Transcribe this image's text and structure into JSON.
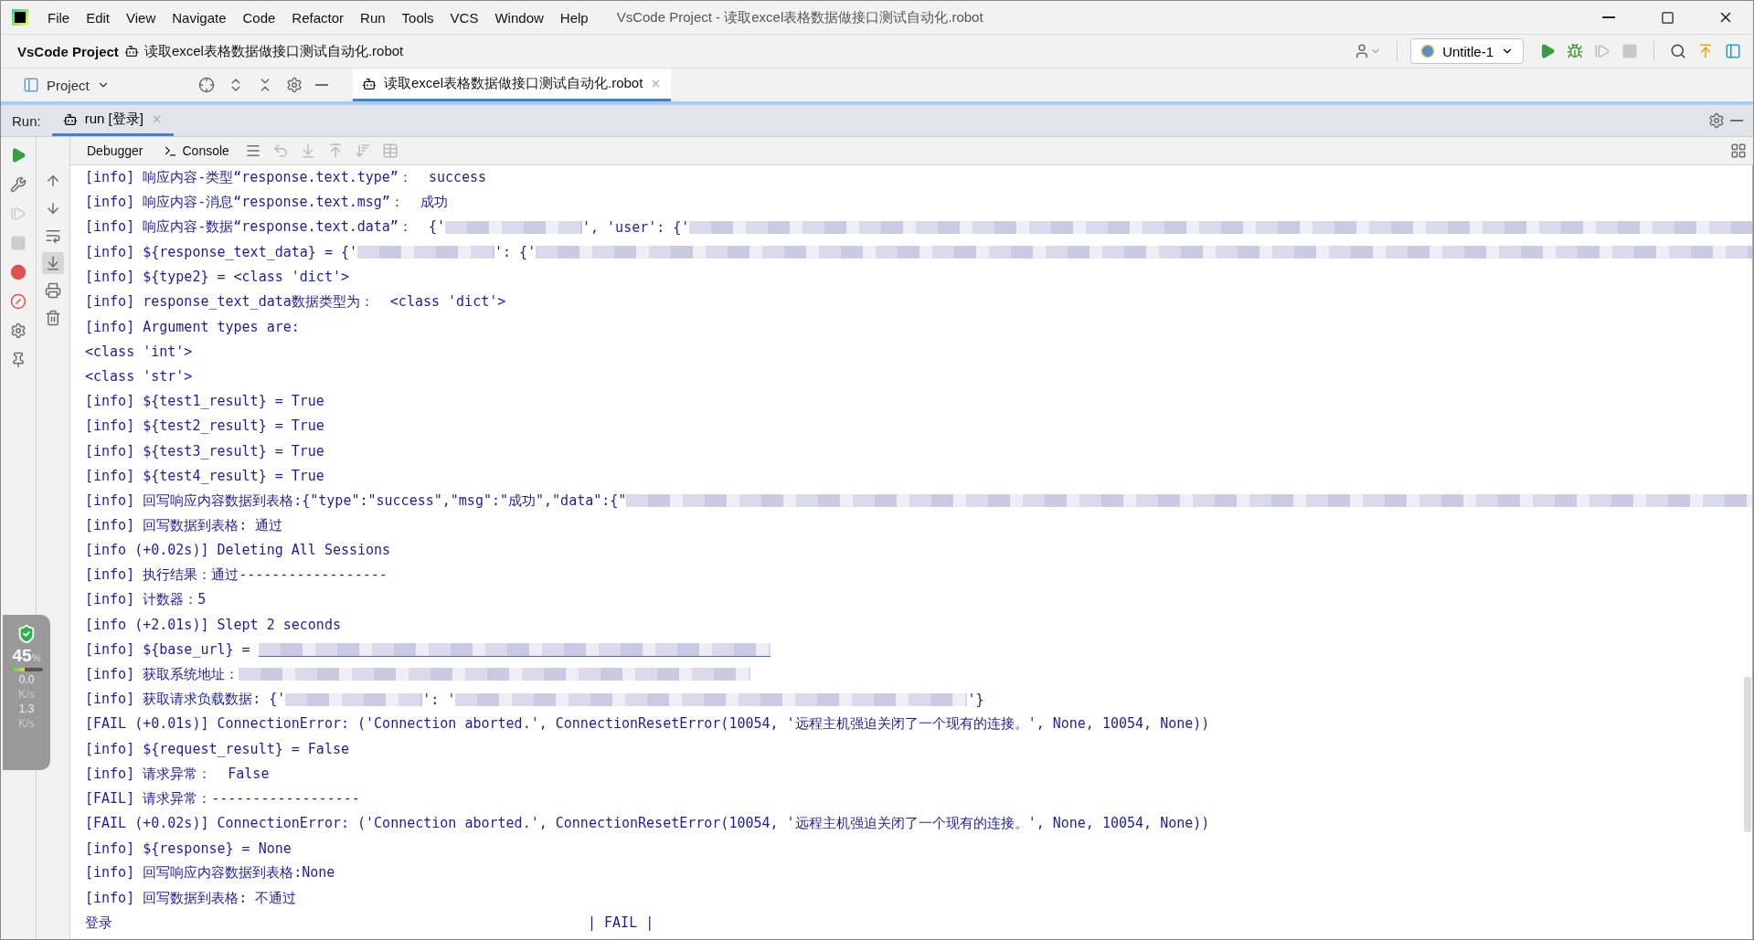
{
  "window": {
    "title": "VsCode Project - 读取excel表格数据做接口测试自动化.robot"
  },
  "menu": [
    {
      "label": "File"
    },
    {
      "label": "Edit"
    },
    {
      "label": "View"
    },
    {
      "label": "Navigate"
    },
    {
      "label": "Code"
    },
    {
      "label": "Refactor"
    },
    {
      "label": "Run"
    },
    {
      "label": "Tools"
    },
    {
      "label": "VCS"
    },
    {
      "label": "Window"
    },
    {
      "label": "Help"
    }
  ],
  "breadcrumb": [
    "VsCode Project",
    "读取excel表格数据做接口测试自动化.robot"
  ],
  "run_config": {
    "label": "Untitle-1"
  },
  "project_panel": {
    "label": "Project"
  },
  "editor_tabs": [
    {
      "label": "读取excel表格数据做接口测试自动化.robot",
      "selected": true
    }
  ],
  "run_panel": {
    "label": "Run:",
    "tabs": [
      {
        "label": "run [登录]",
        "selected": true
      }
    ]
  },
  "console_tabs": [
    {
      "label": "Debugger"
    },
    {
      "label": "Console"
    }
  ],
  "console_lines": [
    {
      "parts": [
        {
          "kind": "text",
          "text": "[info] 响应内容-类型“response.text.type”：  success"
        }
      ]
    },
    {
      "parts": [
        {
          "kind": "text",
          "text": "[info] 响应内容-消息“response.text.msg”：  成功"
        }
      ]
    },
    {
      "parts": [
        {
          "kind": "text",
          "text": "[info] 响应内容-数据“response.text.data”：  {'"
        },
        {
          "kind": "blur"
        },
        {
          "kind": "text",
          "text": "', 'user': {'"
        },
        {
          "kind": "blur_end"
        }
      ]
    },
    {
      "parts": [
        {
          "kind": "text",
          "text": "[info] ${response_text_data} = {'"
        },
        {
          "kind": "blur"
        },
        {
          "kind": "text",
          "text": "': {'"
        },
        {
          "kind": "blur_end"
        }
      ]
    },
    {
      "parts": [
        {
          "kind": "text",
          "text": "[info] ${type2} = <class 'dict'>"
        }
      ]
    },
    {
      "parts": [
        {
          "kind": "text",
          "text": "[info] response_text_data数据类型为：  <class 'dict'>"
        }
      ]
    },
    {
      "parts": [
        {
          "kind": "text",
          "text": "[info] Argument types are:"
        }
      ]
    },
    {
      "parts": [
        {
          "kind": "text",
          "text": "<class 'int'>"
        }
      ]
    },
    {
      "parts": [
        {
          "kind": "text",
          "text": "<class 'str'>"
        }
      ]
    },
    {
      "parts": [
        {
          "kind": "text",
          "text": "[info] ${test1_result} = True"
        }
      ]
    },
    {
      "parts": [
        {
          "kind": "text",
          "text": "[info] ${test2_result} = True"
        }
      ]
    },
    {
      "parts": [
        {
          "kind": "text",
          "text": "[info] ${test3_result} = True"
        }
      ]
    },
    {
      "parts": [
        {
          "kind": "text",
          "text": "[info] ${test4_result} = True"
        }
      ]
    },
    {
      "parts": [
        {
          "kind": "text",
          "text": "[info] 回写响应内容数据到表格:{\"type\":\"success\",\"msg\":\"成功\",\"data\":{\""
        },
        {
          "kind": "blur_end"
        }
      ]
    },
    {
      "parts": [
        {
          "kind": "text",
          "text": "[info] 回写数据到表格: 通过"
        }
      ]
    },
    {
      "parts": [
        {
          "kind": "text",
          "text": "[info (+0.02s)] Deleting All Sessions"
        }
      ]
    },
    {
      "parts": [
        {
          "kind": "text",
          "text": "[info] 执行结果：通过------------------"
        }
      ]
    },
    {
      "parts": [
        {
          "kind": "text",
          "text": "[info] 计数器：5"
        }
      ]
    },
    {
      "parts": [
        {
          "kind": "text",
          "text": "[info (+2.01s)] Slept 2 seconds"
        }
      ]
    },
    {
      "parts": [
        {
          "kind": "text",
          "text": "[info] ${base_url} = "
        },
        {
          "kind": "blur_link"
        }
      ]
    },
    {
      "parts": [
        {
          "kind": "text",
          "text": "[info] 获取系统地址："
        },
        {
          "kind": "blur_long"
        }
      ]
    },
    {
      "parts": [
        {
          "kind": "text",
          "text": "[info] 获取请求负载数据: {'"
        },
        {
          "kind": "blur"
        },
        {
          "kind": "text",
          "text": "': '"
        },
        {
          "kind": "blur_long"
        },
        {
          "kind": "text",
          "text": "'}"
        }
      ]
    },
    {
      "parts": [
        {
          "kind": "text",
          "text": "[FAIL (+0.01s)] ConnectionError: ('Connection aborted.', ConnectionResetError(10054, '远程主机强迫关闭了一个现有的连接。', None, 10054, None))"
        }
      ]
    },
    {
      "parts": [
        {
          "kind": "text",
          "text": "[info] ${request_result} = False"
        }
      ]
    },
    {
      "parts": [
        {
          "kind": "text",
          "text": "[info] 请求异常：  False"
        }
      ]
    },
    {
      "parts": [
        {
          "kind": "text",
          "text": "[FAIL] 请求异常：------------------"
        }
      ]
    },
    {
      "parts": [
        {
          "kind": "text",
          "text": "[FAIL (+0.02s)] ConnectionError: ('Connection aborted.', ConnectionResetError(10054, '远程主机强迫关闭了一个现有的连接。', None, 10054, None))"
        }
      ]
    },
    {
      "parts": [
        {
          "kind": "text",
          "text": "[info] ${response} = None"
        }
      ]
    },
    {
      "parts": [
        {
          "kind": "text",
          "text": "[info] 回写响应内容数据到表格:None"
        }
      ]
    },
    {
      "parts": [
        {
          "kind": "text",
          "text": "[info] 回写数据到表格: 不通过"
        }
      ]
    },
    {
      "parts": [
        {
          "kind": "text",
          "text": "登录"
        },
        {
          "kind": "gap"
        },
        {
          "kind": "text",
          "text": "| FAIL |"
        }
      ]
    }
  ],
  "speed_widget": {
    "percent": "45",
    "unit": "%",
    "level": 0.45,
    "up": "0.0",
    "up_unit": "K/s",
    "down": "1.3",
    "down_unit": "K/s"
  }
}
